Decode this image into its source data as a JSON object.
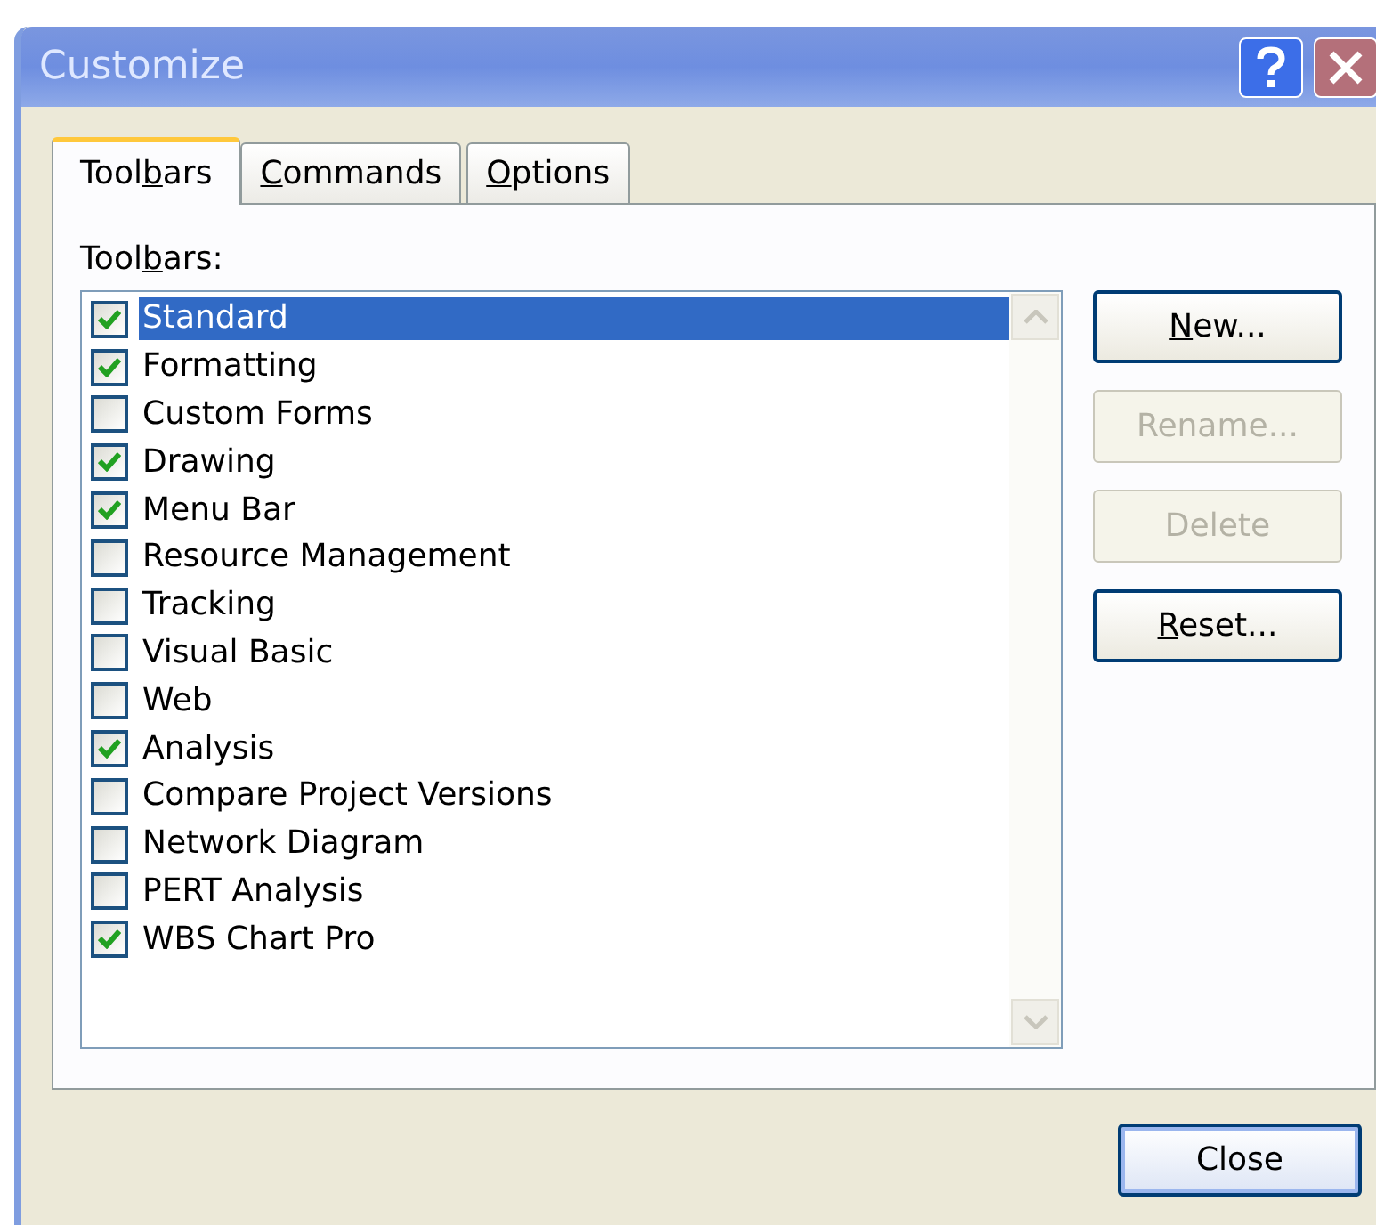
{
  "window": {
    "title": "Customize"
  },
  "tabs": [
    {
      "label": {
        "before": "Tool",
        "access_key": "b",
        "after": "ars"
      },
      "selected": true
    },
    {
      "label": {
        "access_key": "C",
        "after": "ommands"
      },
      "selected": false
    },
    {
      "label": {
        "access_key": "O",
        "after": "ptions"
      },
      "selected": false
    }
  ],
  "toolbars_label": {
    "before": "Tool",
    "access_key": "b",
    "after": "ars:"
  },
  "toolbars": [
    {
      "name": "Standard",
      "checked": true,
      "selected": true
    },
    {
      "name": "Formatting",
      "checked": true,
      "selected": false
    },
    {
      "name": "Custom Forms",
      "checked": false,
      "selected": false
    },
    {
      "name": "Drawing",
      "checked": true,
      "selected": false
    },
    {
      "name": "Menu Bar",
      "checked": true,
      "selected": false
    },
    {
      "name": "Resource Management",
      "checked": false,
      "selected": false
    },
    {
      "name": "Tracking",
      "checked": false,
      "selected": false
    },
    {
      "name": "Visual Basic",
      "checked": false,
      "selected": false
    },
    {
      "name": "Web",
      "checked": false,
      "selected": false
    },
    {
      "name": "Analysis",
      "checked": true,
      "selected": false
    },
    {
      "name": "Compare Project Versions",
      "checked": false,
      "selected": false
    },
    {
      "name": "Network Diagram",
      "checked": false,
      "selected": false
    },
    {
      "name": "PERT Analysis",
      "checked": false,
      "selected": false
    },
    {
      "name": "WBS Chart Pro",
      "checked": true,
      "selected": false
    }
  ],
  "buttons": [
    {
      "label": {
        "access_key": "N",
        "after": "ew..."
      },
      "disabled": false
    },
    {
      "label": "Rename...",
      "disabled": true
    },
    {
      "label": "Delete",
      "disabled": true
    },
    {
      "label": {
        "access_key": "R",
        "after": "eset..."
      },
      "disabled": false
    }
  ],
  "close_button": {
    "label": "Close"
  }
}
